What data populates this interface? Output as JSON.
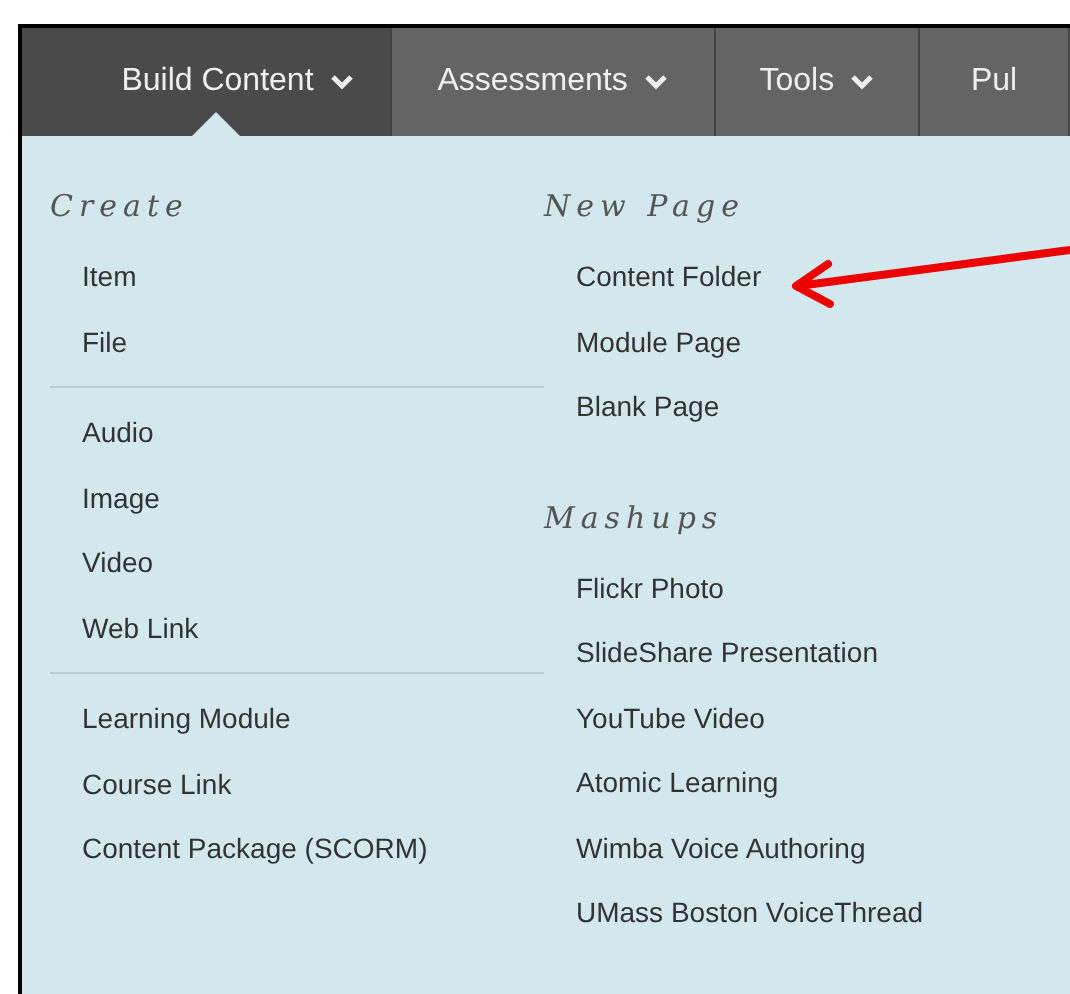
{
  "nav_tabs": [
    {
      "label": "Build Content",
      "selected": true,
      "caret": true
    },
    {
      "label": "Assessments",
      "selected": false,
      "caret": true
    },
    {
      "label": "Tools",
      "selected": false,
      "caret": true
    },
    {
      "label": "Pul",
      "selected": false,
      "caret": false
    }
  ],
  "columns": [
    {
      "heading": "Create",
      "groups": [
        [
          "Item",
          "File"
        ],
        [
          "Audio",
          "Image",
          "Video",
          "Web Link"
        ],
        [
          "Learning Module",
          "Course Link",
          "Content Package (SCORM)"
        ]
      ]
    },
    {
      "heading": "New Page",
      "groups": [
        [
          "Content Folder",
          "Module Page",
          "Blank Page"
        ]
      ],
      "heading_2": "Mashups",
      "groups_2": [
        [
          "Flickr Photo",
          "SlideShare Presentation",
          "YouTube Video",
          "Atomic Learning",
          "Wimba Voice Authoring",
          "UMass Boston VoiceThread"
        ]
      ]
    }
  ]
}
